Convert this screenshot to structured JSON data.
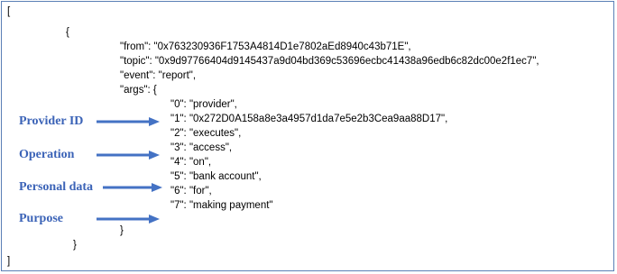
{
  "json_text": {
    "open_bracket": "[",
    "open_brace": "{",
    "from_line": "\"from\": \"0x763230936F1753A4814D1e7802aEd8940c43b71E\",",
    "topic_line": "\"topic\": \"0x9d97766404d9145437a9d04bd369c53696ecbc41438a96edb6c82dc00e2f1ec7\",",
    "event_line": "\"event\": \"report\",",
    "args_line": "\"args\": {",
    "arg0": "\"0\": \"provider\",",
    "arg1": "\"1\": \"0x272D0A158a8e3a4957d1da7e5e2b3Cea9aa88D17\",",
    "arg2": "\"2\": \"executes\",",
    "arg3": "\"3\": \"access\",",
    "arg4": "\"4\": \"on\",",
    "arg5": "\"5\": \"bank account\",",
    "arg6": "\"6\": \"for\",",
    "arg7": "\"7\": \"making payment\"",
    "close_args": "}",
    "close_brace": "}",
    "close_bracket": "]"
  },
  "annotations": {
    "provider_id": "Provider ID",
    "operation": "Operation",
    "personal_data": "Personal data",
    "purpose": "Purpose"
  },
  "colors": {
    "label": "#3b63b7",
    "arrow": "#4472c4",
    "border": "#5a7fb5"
  }
}
